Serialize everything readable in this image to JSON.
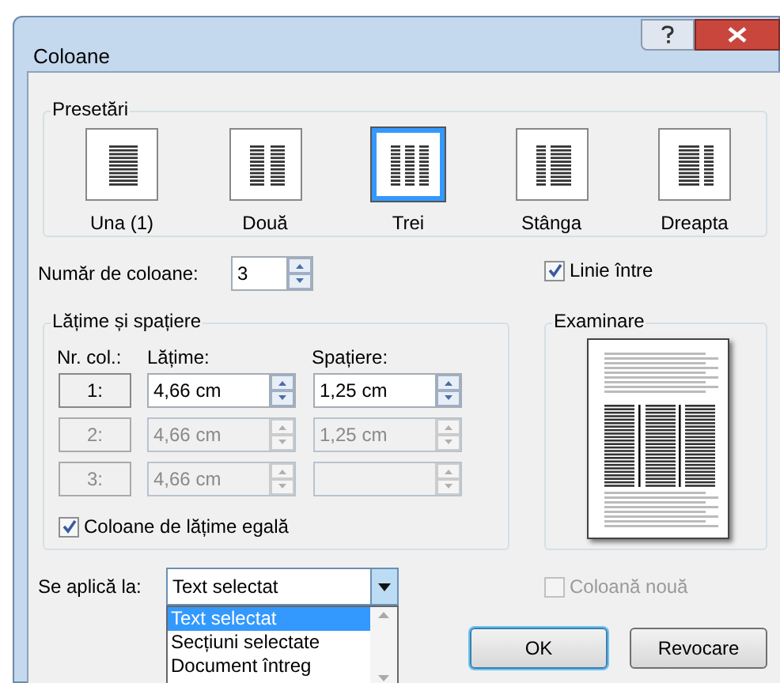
{
  "window": {
    "title": "Coloane"
  },
  "presets": {
    "title": "Presetări",
    "items": [
      {
        "label": "Una (1)",
        "kind": "one",
        "selected": false
      },
      {
        "label": "Două",
        "kind": "two",
        "selected": false
      },
      {
        "label": "Trei",
        "kind": "three",
        "selected": true
      },
      {
        "label": "Stânga",
        "kind": "left",
        "selected": false
      },
      {
        "label": "Dreapta",
        "kind": "right",
        "selected": false
      }
    ]
  },
  "column_count": {
    "label": "Număr de coloane:",
    "value": "3"
  },
  "line_between": {
    "label": "Linie între",
    "checked": true
  },
  "width_spacing": {
    "title": "Lățime și spațiere",
    "headers": [
      "Nr. col.:",
      "Lățime:",
      "Spațiere:"
    ],
    "rows": [
      {
        "label": "1:",
        "width": "4,66 cm",
        "spacing": "1,25 cm",
        "disabled": false
      },
      {
        "label": "2:",
        "width": "4,66 cm",
        "spacing": "1,25 cm",
        "disabled": true
      },
      {
        "label": "3:",
        "width": "4,66 cm",
        "disabled": true
      }
    ],
    "equal_width": {
      "label": "Coloane de lățime egală",
      "checked": true
    }
  },
  "preview": {
    "title": "Examinare"
  },
  "apply_to": {
    "label": "Se aplică la:",
    "value": "Text selectat",
    "options": [
      {
        "label": "Text selectat",
        "selected": true
      },
      {
        "label": "Secțiuni selectate",
        "selected": false
      },
      {
        "label": "Document întreg",
        "selected": false
      }
    ]
  },
  "new_column": {
    "label": "Coloană nouă",
    "checked": false,
    "disabled": true
  },
  "buttons": [
    {
      "label": "OK",
      "default": true
    },
    {
      "label": "Revocare",
      "default": false
    }
  ]
}
